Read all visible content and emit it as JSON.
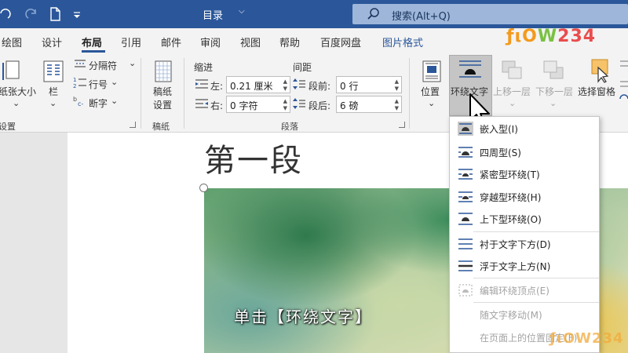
{
  "titlebar": {
    "title": "目录",
    "search_placeholder": "搜索(Alt+Q)"
  },
  "tabs": [
    {
      "label": "绘图"
    },
    {
      "label": "设计"
    },
    {
      "label": "布局"
    },
    {
      "label": "引用"
    },
    {
      "label": "邮件"
    },
    {
      "label": "审阅"
    },
    {
      "label": "视图"
    },
    {
      "label": "帮助"
    },
    {
      "label": "百度网盘"
    },
    {
      "label": "图片格式"
    }
  ],
  "logo": {
    "part1": "ƒιO",
    "part2": "W",
    "part3": "234"
  },
  "ribbon": {
    "page_setup": {
      "size_label": "纸张大小",
      "columns_label": "栏",
      "breaks_label": "分隔符",
      "line_numbers_label": "行号",
      "hyphenation_label": "断字",
      "group_label": "设置"
    },
    "draft": {
      "label_line1": "稿纸",
      "label_line2": "设置",
      "group_label": "稿纸"
    },
    "paragraph": {
      "indent_header": "缩进",
      "spacing_header": "间距",
      "left_label": "左:",
      "left_value": "0.21 厘米",
      "right_label": "右:",
      "right_value": "0 字符",
      "before_label": "段前:",
      "before_value": "0 行",
      "after_label": "段后:",
      "after_value": "6 磅",
      "group_label": "段落"
    },
    "arrange": {
      "position_label": "位置",
      "wrap_text_label": "环绕文字",
      "bring_forward_label": "上移一层",
      "send_backward_label": "下移一层",
      "selection_pane_label": "选择窗格"
    }
  },
  "document": {
    "heading": "第一段",
    "caption": "单击【环绕文字】"
  },
  "wrap_menu": {
    "items": [
      {
        "label": "嵌入型(I)"
      },
      {
        "label": "四周型(S)"
      },
      {
        "label": "紧密型环绕(T)"
      },
      {
        "label": "穿越型环绕(H)"
      },
      {
        "label": "上下型环绕(O)"
      },
      {
        "label": "衬于文字下方(D)"
      },
      {
        "label": "浮于文字上方(N)"
      },
      {
        "label": "编辑环绕顶点(E)"
      },
      {
        "label": "随文字移动(M)"
      },
      {
        "label": "在页面上的位置固定(F)"
      }
    ]
  },
  "watermark": {
    "text": "ƒιOW234"
  },
  "colors": {
    "accent": "#2b579a",
    "ribbon_bg": "#f3f3f3",
    "highlight": "#c5c5c5"
  }
}
